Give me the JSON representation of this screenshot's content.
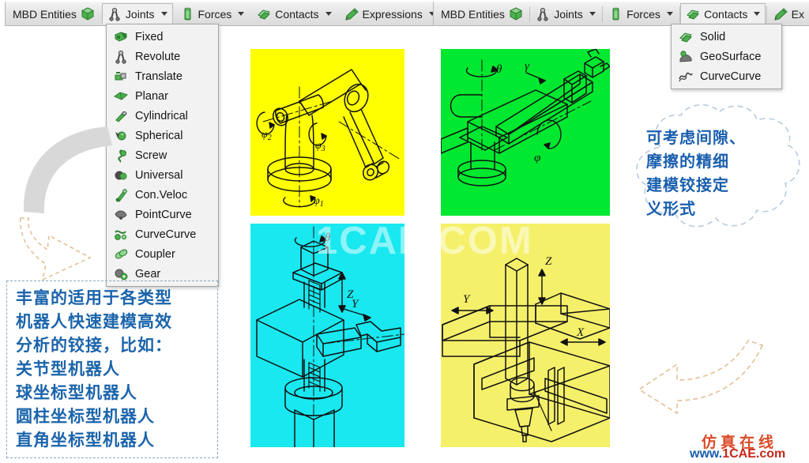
{
  "toolbars": {
    "left": {
      "items": [
        {
          "label": "MBD Entities",
          "icon": "green-cube-icon",
          "caret": false,
          "active": false
        },
        {
          "label": "Joints",
          "icon": "joint-revolute-icon",
          "caret": true,
          "active": true
        },
        {
          "label": "Forces",
          "icon": "force-cylinder-icon",
          "caret": true,
          "active": false
        },
        {
          "label": "Contacts",
          "icon": "contact-solid-icon",
          "caret": true,
          "active": false
        },
        {
          "label": "Expressions",
          "icon": "expression-pen-icon",
          "caret": true,
          "active": false
        }
      ]
    },
    "right": {
      "items": [
        {
          "label": "MBD Entities",
          "icon": "green-cube-icon",
          "caret": false,
          "active": false
        },
        {
          "label": "Joints",
          "icon": "joint-revolute-icon",
          "caret": true,
          "active": false
        },
        {
          "label": "Forces",
          "icon": "force-cylinder-icon",
          "caret": true,
          "active": false
        },
        {
          "label": "Contacts",
          "icon": "contact-solid-icon",
          "caret": true,
          "active": true
        },
        {
          "label": "Ex",
          "icon": "expression-pen-icon",
          "caret": false,
          "active": false
        }
      ]
    }
  },
  "menus": {
    "joints": {
      "items": [
        {
          "label": "Fixed",
          "icon": "joint-fixed-icon"
        },
        {
          "label": "Revolute",
          "icon": "joint-revolute-icon"
        },
        {
          "label": "Translate",
          "icon": "joint-translate-icon"
        },
        {
          "label": "Planar",
          "icon": "joint-planar-icon"
        },
        {
          "label": "Cylindrical",
          "icon": "joint-cylindrical-icon"
        },
        {
          "label": "Spherical",
          "icon": "joint-spherical-icon"
        },
        {
          "label": "Screw",
          "icon": "joint-screw-icon"
        },
        {
          "label": "Universal",
          "icon": "joint-universal-icon"
        },
        {
          "label": "Con.Veloc",
          "icon": "joint-conveloc-icon"
        },
        {
          "label": "PointCurve",
          "icon": "joint-pointcurve-icon"
        },
        {
          "label": "CurveCurve",
          "icon": "joint-curvecurve-icon"
        },
        {
          "label": "Coupler",
          "icon": "joint-coupler-icon"
        },
        {
          "label": "Gear",
          "icon": "joint-gear-icon"
        }
      ]
    },
    "contacts": {
      "items": [
        {
          "label": "Solid",
          "icon": "contact-solid-icon"
        },
        {
          "label": "GeoSurface",
          "icon": "contact-geosurface-icon"
        },
        {
          "label": "CurveCurve",
          "icon": "contact-curvecurve-icon"
        }
      ]
    }
  },
  "panels": [
    {
      "name": "articulated-robot",
      "bg": "#ffff00",
      "labels": [
        "φ",
        "1",
        "2",
        "3"
      ],
      "annotations": [
        "φ₁",
        "φ₂",
        "φ₃"
      ]
    },
    {
      "name": "spherical-robot",
      "bg": "#00e830",
      "annotations": [
        "θ",
        "γ",
        "φ"
      ]
    },
    {
      "name": "cylindrical-robot",
      "bg": "#19e8f0",
      "annotations": [
        "θ",
        "Z",
        "Y"
      ]
    },
    {
      "name": "cartesian-robot",
      "bg": "#f5f06a",
      "annotations": [
        "Z",
        "Y",
        "X"
      ]
    }
  ],
  "callouts": {
    "left_note": "丰富的适用于各类型\n机器人快速建模高效\n分析的铰接，比如：\n关节型机器人\n球坐标型机器人\n圆柱坐标型机器人\n直角坐标型机器人",
    "cloud_note": "可考虑间隙、\n摩擦的精细\n建模铰接定\n义形式"
  },
  "watermarks": {
    "center": "1CAE.COM",
    "brand_cn": "仿真在线",
    "brand_url_blue": "www.",
    "brand_url_red": "1CAE.com"
  },
  "colors": {
    "accent_blue": "#1a5fae",
    "arrow_gray": "#d6d6d6",
    "arrow_outline": "#e6c9a3",
    "panel_yellow": "#ffff00",
    "panel_green": "#00e830",
    "panel_cyan": "#19e8f0",
    "panel_lightyellow": "#f5f06a"
  }
}
